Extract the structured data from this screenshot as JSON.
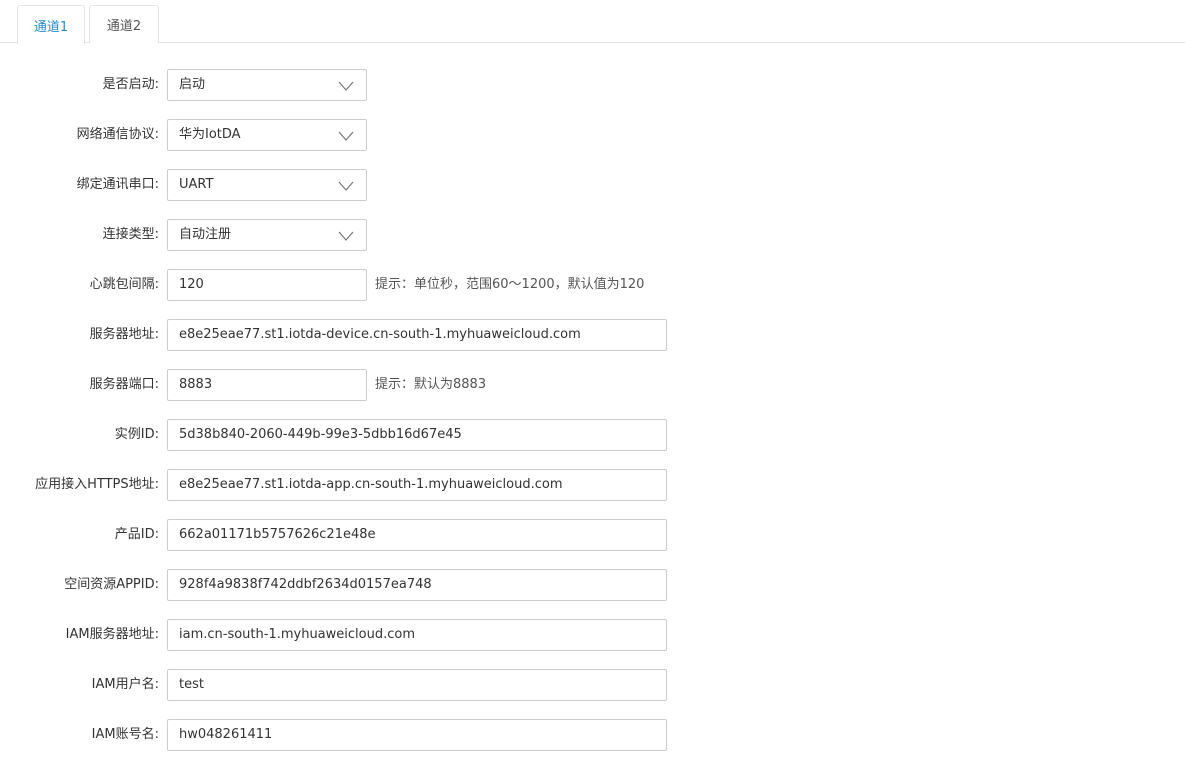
{
  "tabs": [
    {
      "label": "通道1",
      "active": true
    },
    {
      "label": "通道2",
      "active": false
    }
  ],
  "fields": {
    "enabled": {
      "label": "是否启动:",
      "value": "启动"
    },
    "protocol": {
      "label": "网络通信协议:",
      "value": "华为IotDA"
    },
    "serial_port": {
      "label": "绑定通讯串口:",
      "value": "UART"
    },
    "connect_type": {
      "label": "连接类型:",
      "value": "自动注册"
    },
    "heartbeat": {
      "label": "心跳包间隔:",
      "value": "120",
      "hint": "提示：单位秒，范围60～1200，默认值为120"
    },
    "server_addr": {
      "label": "服务器地址:",
      "value": "e8e25eae77.st1.iotda-device.cn-south-1.myhuaweicloud.com"
    },
    "server_port": {
      "label": "服务器端口:",
      "value": "8883",
      "hint": "提示：默认为8883"
    },
    "instance_id": {
      "label": "实例ID:",
      "value": "5d38b840-2060-449b-99e3-5dbb16d67e45"
    },
    "https_addr": {
      "label": "应用接入HTTPS地址:",
      "value": "e8e25eae77.st1.iotda-app.cn-south-1.myhuaweicloud.com"
    },
    "product_id": {
      "label": "产品ID:",
      "value": "662a01171b5757626c21e48e"
    },
    "space_appid": {
      "label": "空间资源APPID:",
      "value": "928f4a9838f742ddbf2634d0157ea748"
    },
    "iam_server": {
      "label": "IAM服务器地址:",
      "value": "iam.cn-south-1.myhuaweicloud.com"
    },
    "iam_user": {
      "label": "IAM用户名:",
      "value": "test"
    },
    "iam_account": {
      "label": "IAM账号名:",
      "value": "hw048261411"
    }
  },
  "colors": {
    "active_tab": "#2b8ac6",
    "border": "#cccccc"
  }
}
